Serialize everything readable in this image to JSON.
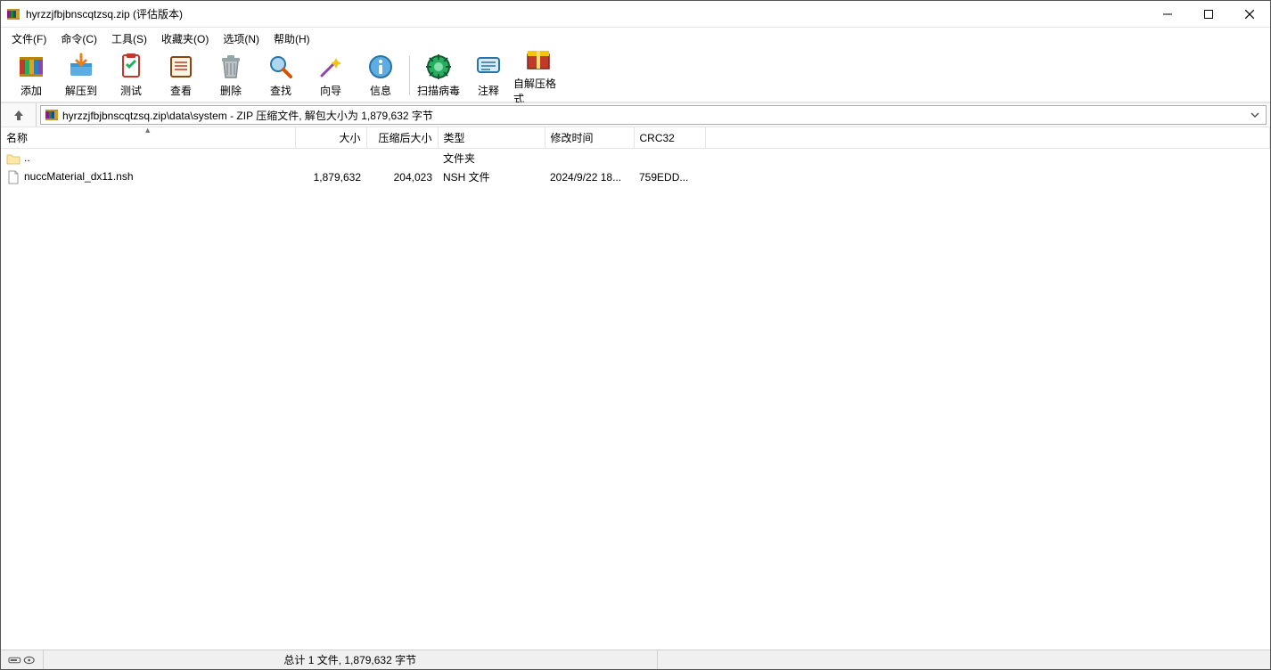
{
  "titlebar": {
    "title": "hyrzzjfbjbnscqtzsq.zip (评估版本)"
  },
  "menubar": {
    "items": [
      "文件(F)",
      "命令(C)",
      "工具(S)",
      "收藏夹(O)",
      "选项(N)",
      "帮助(H)"
    ]
  },
  "toolbar": {
    "add": "添加",
    "extract": "解压到",
    "test": "测试",
    "view": "查看",
    "delete": "删除",
    "find": "查找",
    "wizard": "向导",
    "info": "信息",
    "virus": "扫描病毒",
    "comment": "注释",
    "sfx": "自解压格式"
  },
  "addressbar": {
    "path": "hyrzzjfbjbnscqtzsq.zip\\data\\system - ZIP 压缩文件, 解包大小为 1,879,632 字节"
  },
  "columns": {
    "name": "名称",
    "size": "大小",
    "packed": "压缩后大小",
    "type": "类型",
    "mtime": "修改时间",
    "crc": "CRC32"
  },
  "rows": {
    "parent": {
      "name": "..",
      "type": "文件夹"
    },
    "r1": {
      "name": "nuccMaterial_dx11.nsh",
      "size": "1,879,632",
      "packed": "204,023",
      "type": "NSH 文件",
      "mtime": "2024/9/22 18...",
      "crc": "759EDD..."
    }
  },
  "statusbar": {
    "summary": "总计 1 文件, 1,879,632 字节"
  }
}
